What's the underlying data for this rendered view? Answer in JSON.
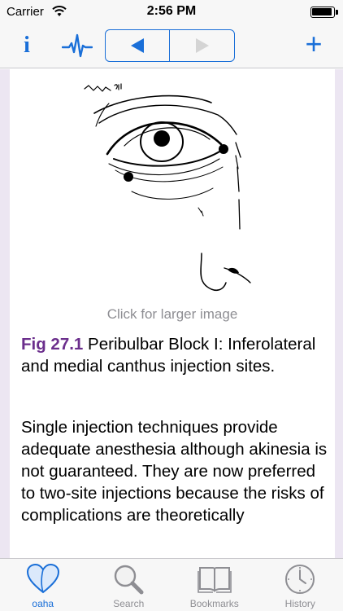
{
  "status": {
    "carrier": "Carrier",
    "time": "2:56 PM"
  },
  "navbar": {
    "info_icon": "info-icon",
    "pulse_icon": "pulse-icon",
    "back_icon": "triangle-left-icon",
    "forward_icon": "triangle-right-icon",
    "add_icon": "plus-icon",
    "info_glyph": "i",
    "plus_glyph": "+"
  },
  "content": {
    "image_caption": "Click for larger image",
    "figure_number": "Fig 27.1",
    "figure_title": " Peribulbar Block I: Inferolateral and medial canthus injection sites.",
    "body": "Single injection techniques provide adequate anesthesia although akinesia is not guaranteed. They are now preferred to two-site injections because the risks of complications are theoretically"
  },
  "tabs": [
    {
      "label": "oaha",
      "icon": "heart-icon",
      "active": true
    },
    {
      "label": "Search",
      "icon": "search-icon",
      "active": false
    },
    {
      "label": "Bookmarks",
      "icon": "book-icon",
      "active": false
    },
    {
      "label": "History",
      "icon": "clock-icon",
      "active": false
    }
  ],
  "colors": {
    "accent": "#1a6fd8",
    "figure_number": "#6b2e8c",
    "content_background": "#ece6f2",
    "inactive_tab": "#8e8e93"
  }
}
